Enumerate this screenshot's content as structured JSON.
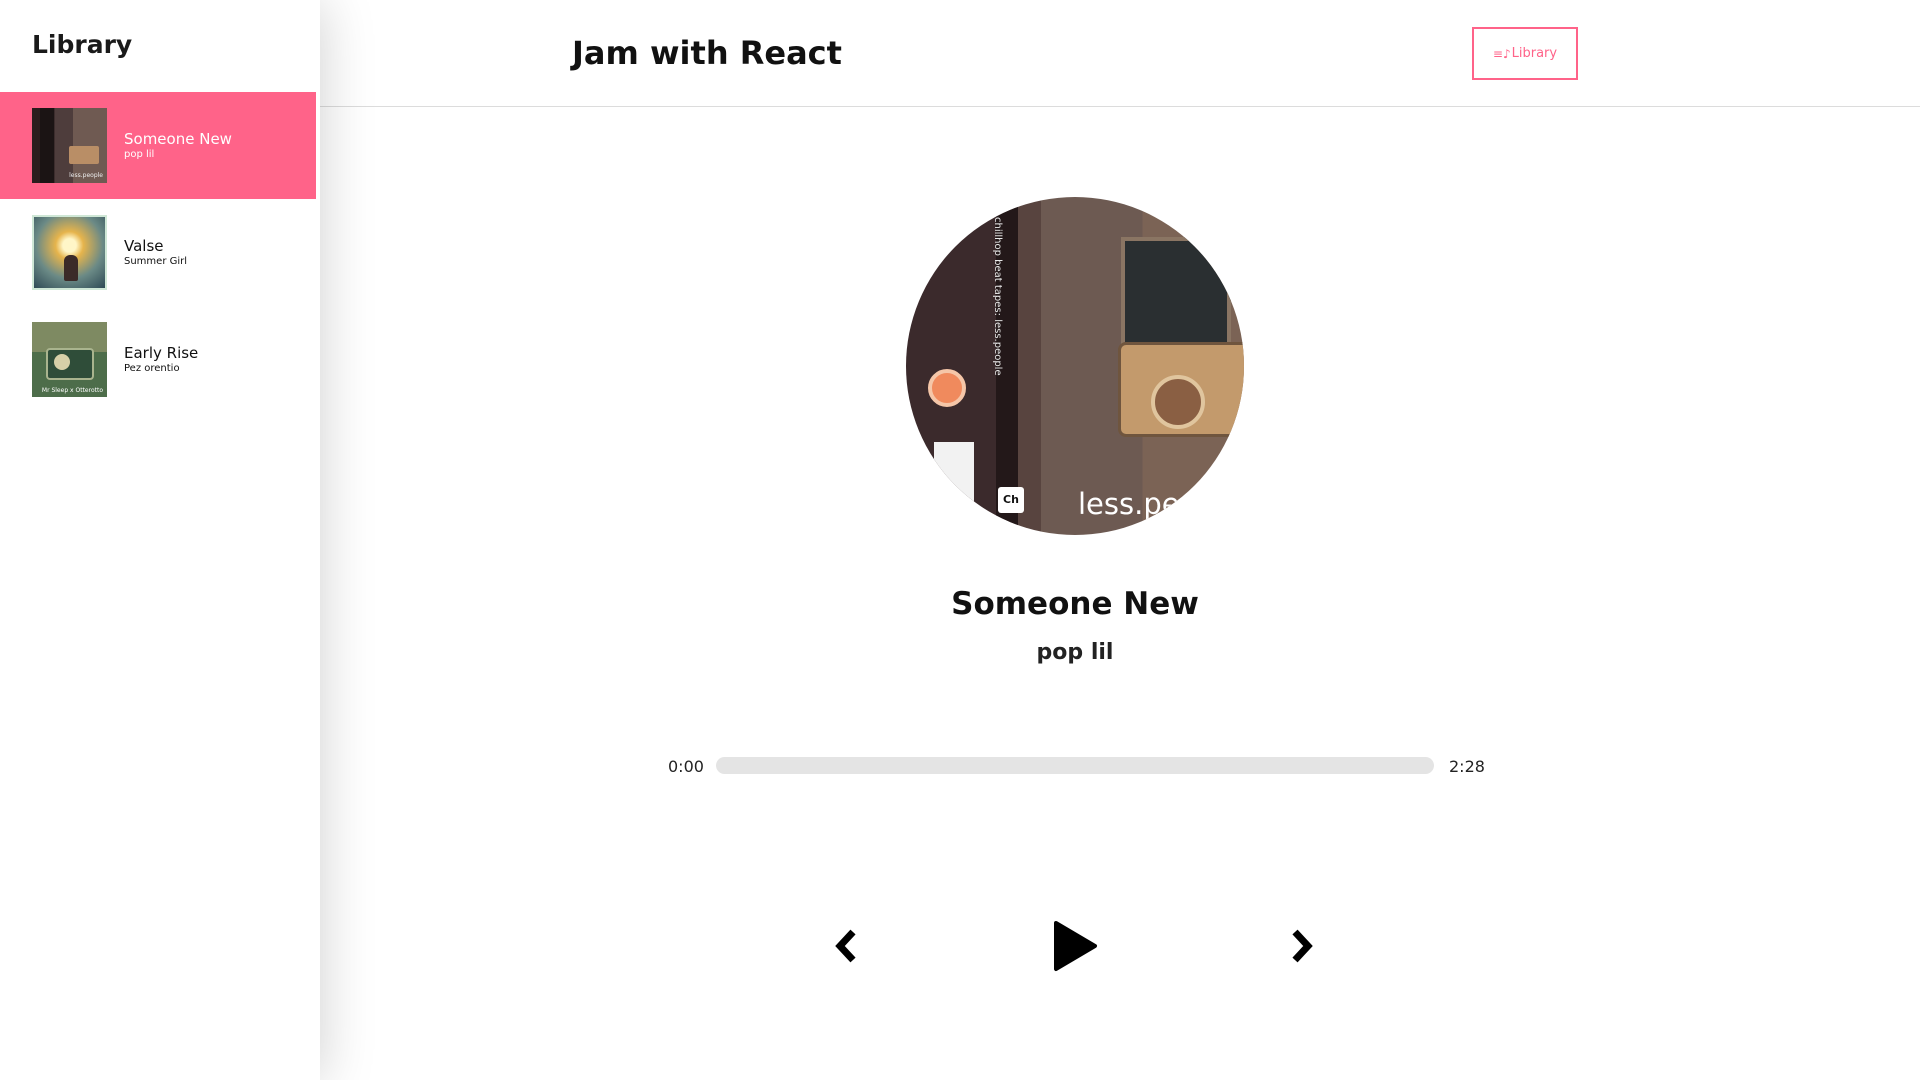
{
  "sidebar": {
    "title": "Library",
    "songs": [
      {
        "name": "Someone New",
        "artist": "pop lil",
        "active": true,
        "cover_text": "less.people"
      },
      {
        "name": "Valse",
        "artist": "Summer Girl",
        "active": false
      },
      {
        "name": "Early Rise",
        "artist": "Pez orentio",
        "active": false,
        "cover_text": "Mr Sleep x Otterotto"
      }
    ]
  },
  "header": {
    "title": "Jam with React",
    "library_button": {
      "icon": "music-list-icon",
      "icon_glyph": "≡♪",
      "label": "Library"
    }
  },
  "player": {
    "art_text": "less.pe",
    "art_brand": "Ch",
    "art_vertical_text": "chillhop beat tapes: less.people",
    "title": "Someone New",
    "artist": "pop lil",
    "time_current": "0:00",
    "time_total": "2:28",
    "progress_fraction": 0,
    "controls": [
      "chevron-left-icon",
      "play-icon",
      "chevron-right-icon"
    ]
  },
  "colors": {
    "accent": "#ff6389",
    "text": "#111111",
    "track_bg": "#e4e4e4"
  }
}
